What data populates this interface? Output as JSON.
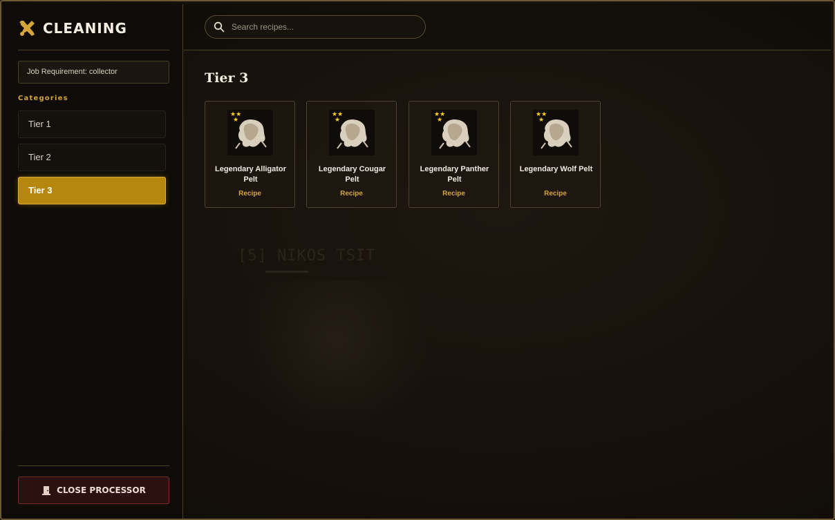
{
  "app": {
    "title": "CLEANING",
    "icon": "crossed-tools-icon",
    "accent": "#d4a53a"
  },
  "sidebar": {
    "job_requirement": "Job Requirement: collector",
    "categories_label": "Categories",
    "categories": [
      {
        "label": "Tier 1",
        "active": false
      },
      {
        "label": "Tier 2",
        "active": false
      },
      {
        "label": "Tier 3",
        "active": true
      }
    ],
    "close_button": {
      "label": "CLOSE PROCESSOR",
      "icon": "door-icon"
    }
  },
  "search": {
    "placeholder": "Search recipes...",
    "value": "",
    "icon": "search-icon"
  },
  "main": {
    "section_title": "Tier 3",
    "background_text": "[5] NIKOS TSIT",
    "cards": [
      {
        "name": "Legendary Alligator Pelt",
        "tag": "Recipe",
        "stars": "★★\n★",
        "icon": "pelt-icon"
      },
      {
        "name": "Legendary Cougar Pelt",
        "tag": "Recipe",
        "stars": "★★\n★",
        "icon": "pelt-icon"
      },
      {
        "name": "Legendary Panther Pelt",
        "tag": "Recipe",
        "stars": "★★\n★",
        "icon": "pelt-icon"
      },
      {
        "name": "Legendary Wolf Pelt",
        "tag": "Recipe",
        "stars": "★★\n★",
        "icon": "pelt-icon"
      }
    ]
  }
}
